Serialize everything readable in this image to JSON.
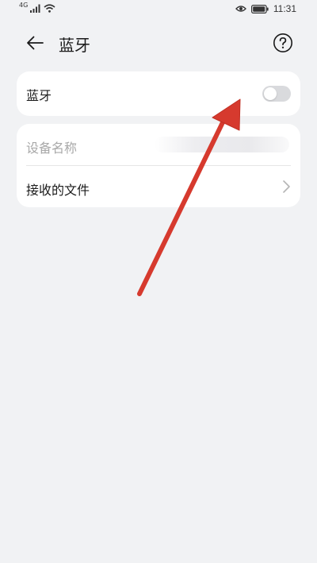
{
  "status_bar": {
    "network_label": "4G",
    "time": "11:31",
    "icons": [
      "signal-icon",
      "wifi-icon",
      "eye-icon",
      "battery-icon"
    ]
  },
  "header": {
    "title": "蓝牙",
    "back_icon": "arrow-left-icon",
    "help_icon": "question-circle-icon"
  },
  "bluetooth": {
    "label": "蓝牙",
    "enabled": false
  },
  "device": {
    "name_label": "设备名称",
    "received_files_label": "接收的文件"
  },
  "colors": {
    "background": "#f1f2f4",
    "card": "#ffffff",
    "toggle_off": "#d9dadd",
    "annotation_arrow": "#d63a2e"
  }
}
